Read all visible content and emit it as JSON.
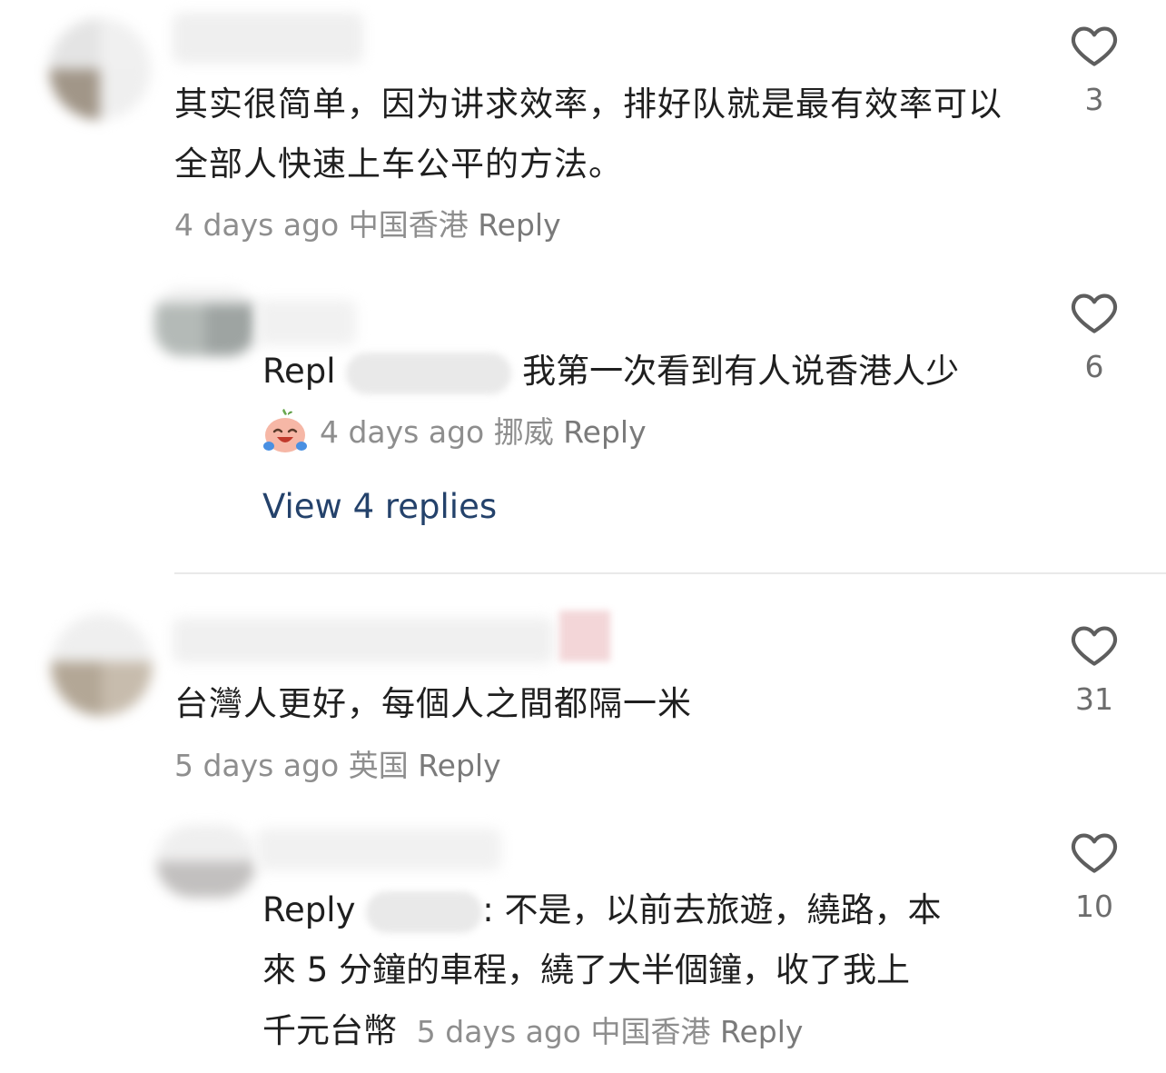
{
  "comments": [
    {
      "text": "其实很简单，因为讲求效率，排好队就是最有效率可以全部人快速上车公平的方法。",
      "time": "4 days ago",
      "location": "中国香港",
      "reply_label": "Reply",
      "likes": "3"
    },
    {
      "prefix": "Repl",
      "text": "我第一次看到有人说香港人少",
      "time": "4 days ago",
      "location": "挪威",
      "reply_label": "Reply",
      "likes": "6",
      "view_replies": "View 4 replies"
    },
    {
      "text": "台灣人更好，每個人之間都隔一米",
      "time": "5 days ago",
      "location": "英国",
      "reply_label": "Reply",
      "likes": "31"
    },
    {
      "prefix": "Reply",
      "text_line1": ": 不是，以前去旅遊，繞路，本",
      "text_line2": "來 5 分鐘的車程，繞了大半個鐘，收了我上",
      "text_line3": "千元台幣",
      "time": "5 days ago",
      "location": "中国香港",
      "reply_label": "Reply",
      "likes": "10"
    }
  ],
  "icons": {
    "like": "heart-outline-icon",
    "emoji": "crying-laughing-emoji-icon"
  },
  "colors": {
    "text": "#1f1f1f",
    "meta": "#8e8e8e",
    "link": "#24426b",
    "divider": "#e9e9e9"
  }
}
